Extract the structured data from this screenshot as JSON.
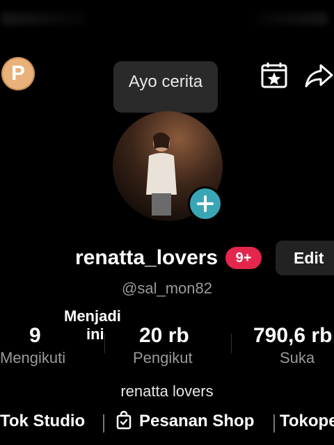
{
  "tooltip": {
    "text": "Ayo cerita"
  },
  "badge_p": {
    "letter": "P"
  },
  "profile": {
    "username": "renatta_lovers",
    "notifications": "9+",
    "edit_label": "Edit",
    "handle": "@sal_mon82",
    "nickname": "renatta lovers"
  },
  "overlay": {
    "line1": "Menjadi",
    "line2": "ini"
  },
  "stats": [
    {
      "value": "9",
      "label": "Mengikuti"
    },
    {
      "value": "20 rb",
      "label": "Pengikut"
    },
    {
      "value": "790,6 rb",
      "label": "Suka"
    }
  ],
  "links": {
    "studio": "Tok Studio",
    "shop": "Pesanan Shop",
    "more": "Tokope"
  },
  "icons": {
    "calendar": "calendar-star-icon",
    "share": "share-arrow-icon",
    "add": "plus-icon",
    "shop": "shopping-bag-check-icon"
  },
  "colors": {
    "notif_badge": "#e4264d",
    "add_badge": "#3aa6b5",
    "p_badge": "#e8b27a"
  }
}
